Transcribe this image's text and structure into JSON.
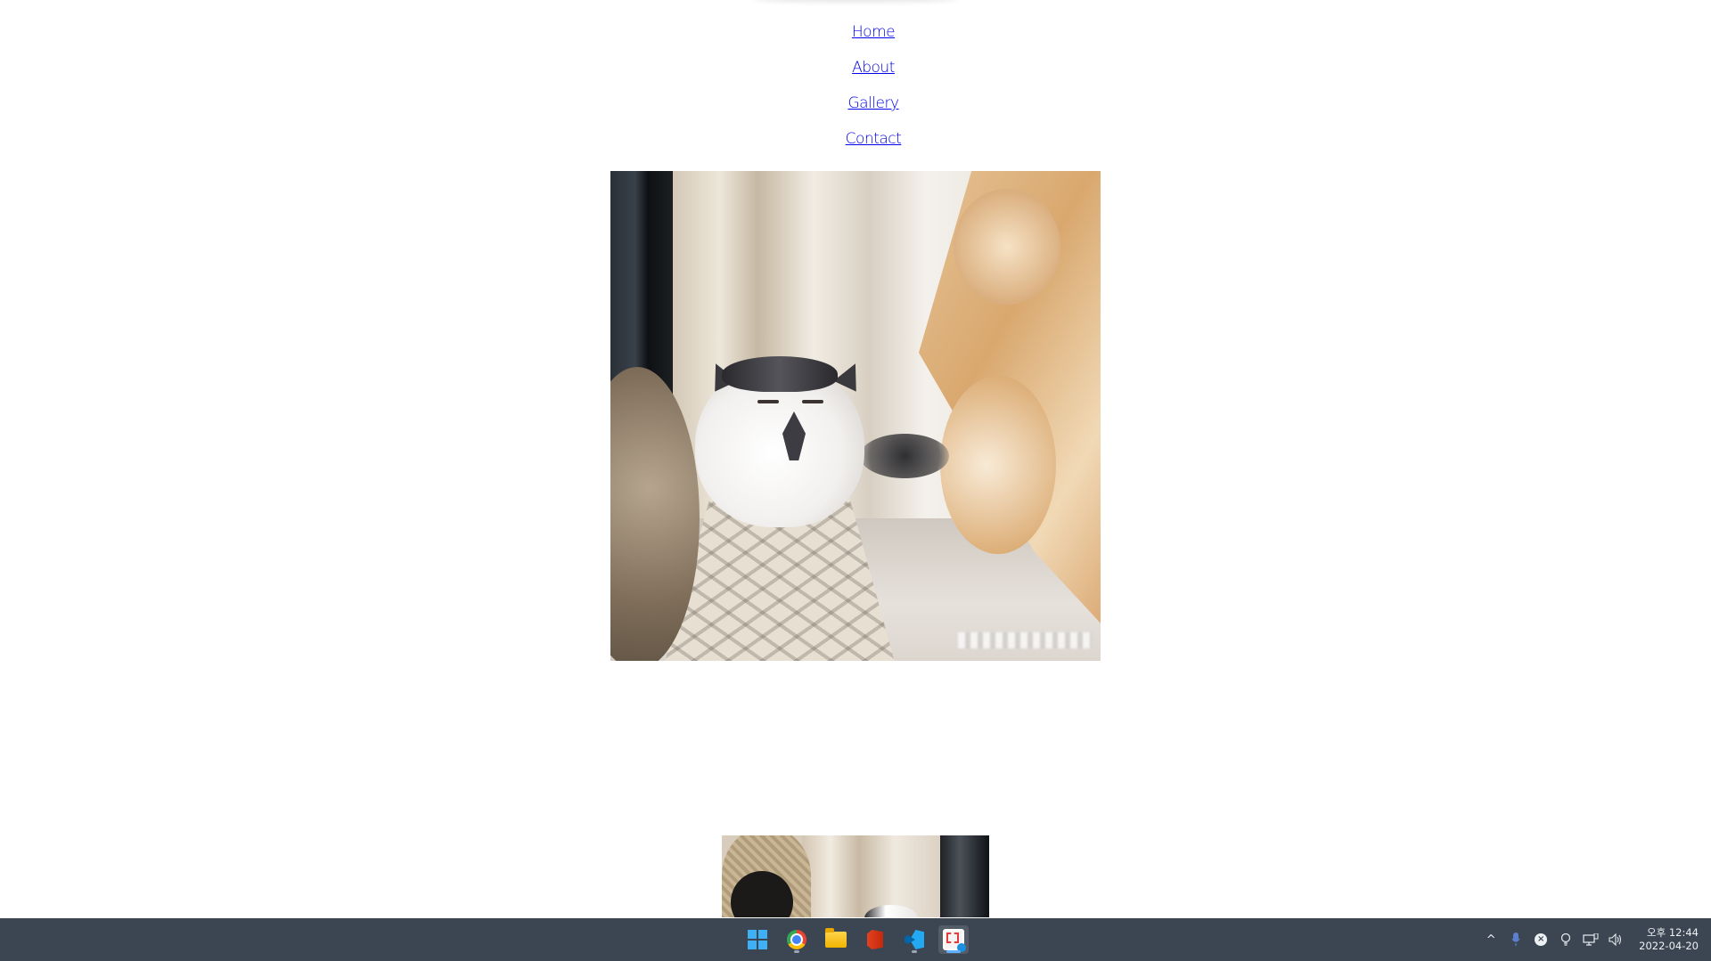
{
  "nav": {
    "links": [
      "Home",
      "About",
      "Gallery",
      "Contact"
    ]
  },
  "gallery": {
    "images": [
      {
        "description_icon": "cat-photo"
      },
      {
        "description_icon": "cat-photo"
      }
    ]
  },
  "taskbar": {
    "apps": [
      {
        "icon": "windows-start-icon"
      },
      {
        "icon": "chrome-icon"
      },
      {
        "icon": "file-explorer-icon"
      },
      {
        "icon": "office-icon"
      },
      {
        "icon": "vscode-icon"
      },
      {
        "icon": "snipping-tool-icon"
      }
    ],
    "tray": {
      "chevron": "^",
      "time": "오후 12:44",
      "date": "2022-04-20"
    }
  },
  "colors": {
    "link": "#0000ee",
    "taskbar_bg": "#3c4653",
    "accent": "#3fb0f5"
  }
}
